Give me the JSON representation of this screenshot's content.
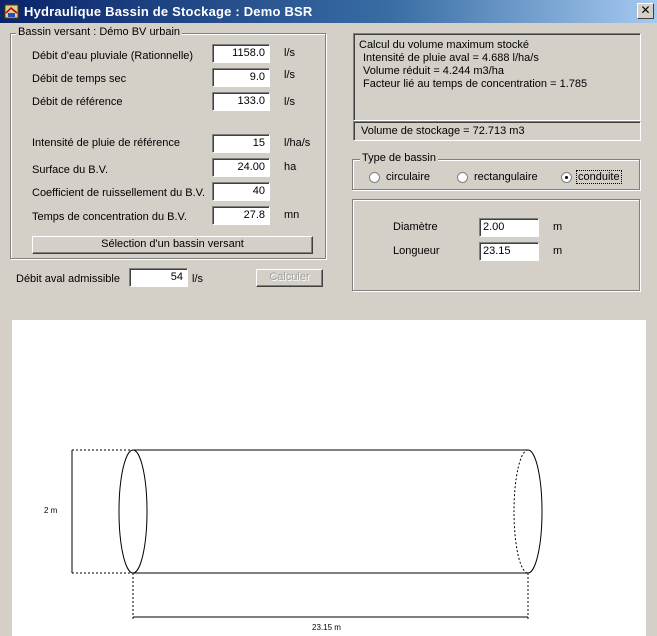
{
  "window": {
    "title": "Hydraulique Bassin de  Stockage : Demo BSR",
    "close_glyph": "✕"
  },
  "bassin_versant": {
    "legend": "Bassin versant : Démo BV urbain",
    "rows": [
      {
        "label": "Débit d'eau pluviale (Rationnelle)",
        "value": "1158.0",
        "unit": "l/s"
      },
      {
        "label": "Débit de temps sec",
        "value": "9.0",
        "unit": "l/s"
      },
      {
        "label": "Débit de référence",
        "value": "133.0",
        "unit": "l/s"
      },
      {
        "label": "Intensité de pluie de référence",
        "value": "15",
        "unit": "l/ha/s"
      },
      {
        "label": "Surface du B.V.",
        "value": "24.00",
        "unit": "ha"
      },
      {
        "label": "Coefficient de ruissellement du B.V.",
        "value": "40",
        "unit": ""
      },
      {
        "label": "Temps de concentration du B.V.",
        "value": "27.8",
        "unit": "mn"
      }
    ],
    "select_button": "Sélection d'un bassin versant"
  },
  "debit_aval": {
    "label": "Débit aval admissible",
    "value": "54",
    "unit": "l/s"
  },
  "calculer_button": "Calculer",
  "calcul": {
    "lines": [
      "Calcul du volume maximum stocké",
      "Intensité de pluie aval   = 4.688 l/ha/s",
      "Volume réduit   = 4.244 m3/ha",
      "Facteur lié au temps de concentration    = 1.785"
    ],
    "volume": "Volume de stockage   = 72.713 m3"
  },
  "type_bassin": {
    "legend": "Type de bassin",
    "options": [
      {
        "label": "circulaire",
        "selected": false
      },
      {
        "label": "rectangulaire",
        "selected": false
      },
      {
        "label": "conduite",
        "selected": true
      }
    ]
  },
  "dimensions": [
    {
      "label": "Diamètre",
      "value": "2.00",
      "unit": "m"
    },
    {
      "label": "Longueur",
      "value": "23.15",
      "unit": "m"
    }
  ],
  "drawing": {
    "diameter_label": "2 m",
    "length_label": "23.15 m"
  },
  "colors": {
    "title_start": "#0a246a",
    "title_end": "#a6caf0",
    "window_bg": "#d4d0c8"
  }
}
